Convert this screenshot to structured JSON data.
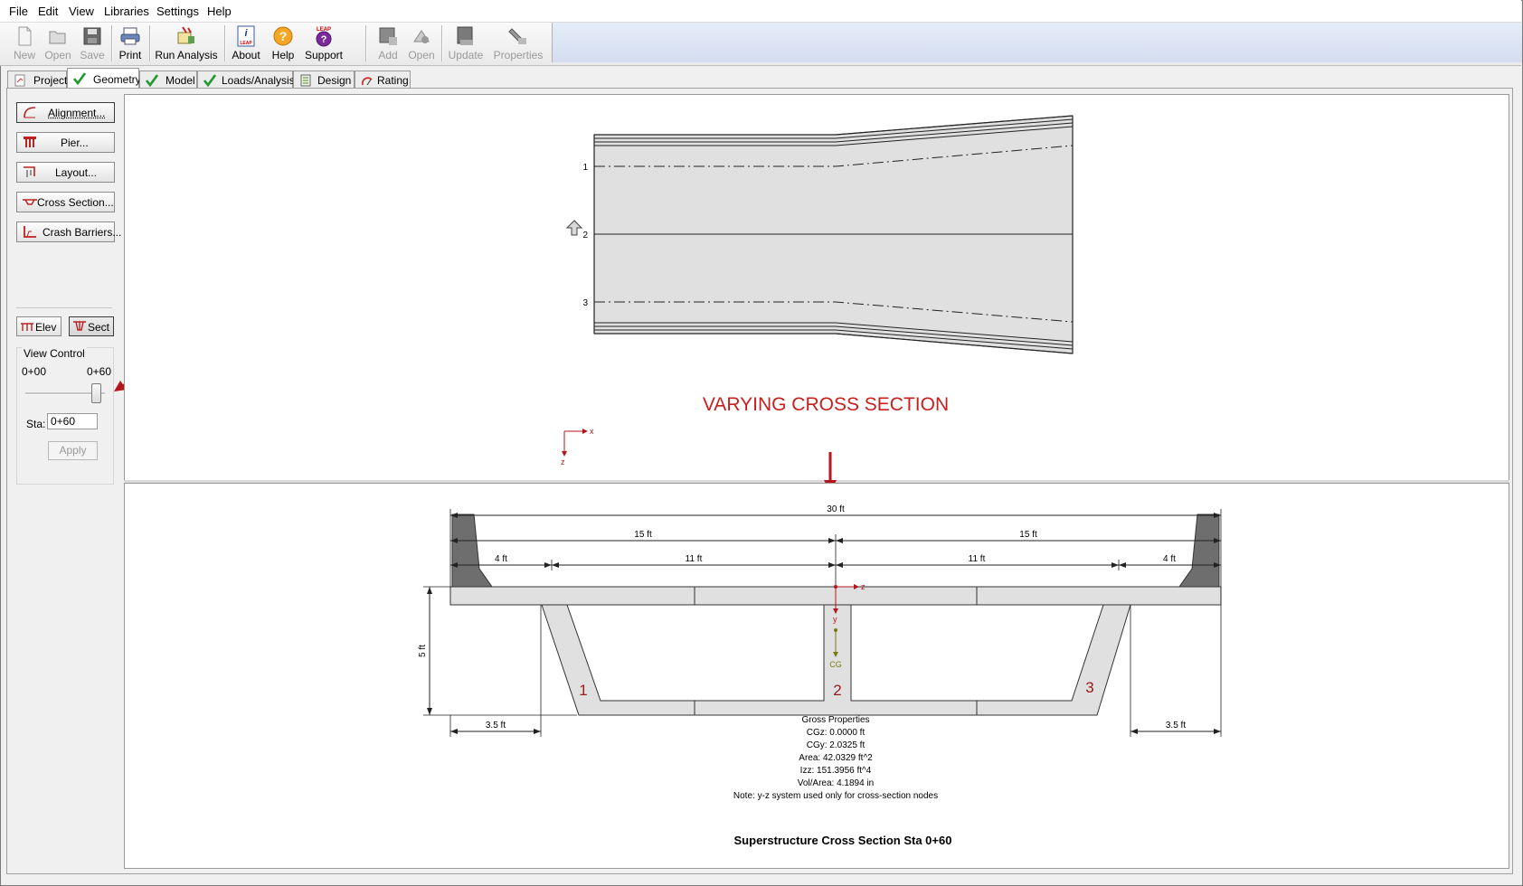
{
  "menu": [
    "File",
    "Edit",
    "View",
    "Libraries",
    "Settings",
    "Help"
  ],
  "toolbar": {
    "new": "New",
    "open": "Open",
    "save": "Save",
    "print": "Print",
    "run_analysis": "Run Analysis",
    "about": "About",
    "help": "Help",
    "support": "Support",
    "add": "Add",
    "open2": "Open",
    "update": "Update",
    "properties": "Properties",
    "about_badge": "LEAP",
    "support_badge": "LEAP"
  },
  "tabs": [
    "Project",
    "Geometry",
    "Model",
    "Loads/Analysis",
    "Design",
    "Rating"
  ],
  "active_tab": "Geometry",
  "sidebar": {
    "alignment": "Alignment...",
    "pier": "Pier...",
    "layout": "Layout...",
    "cross_section": "Cross Section...",
    "crash_barriers": "Crash Barriers...",
    "elev": "Elev",
    "sect": "Sect"
  },
  "view_control": {
    "title": "View Control",
    "min": "0+00",
    "max": "0+60",
    "slider_fraction": 1.0,
    "sta_label": "Sta:",
    "sta_value": "0+60",
    "apply": "Apply"
  },
  "plan_view": {
    "title": "VARYING CROSS SECTION",
    "girder_labels": [
      "1",
      "2",
      "3"
    ],
    "axis_x": "x",
    "axis_z": "z"
  },
  "section_view": {
    "dims": {
      "overall": "30 ft",
      "half_left": "15 ft",
      "half_right": "15 ft",
      "left_overhang": "4 ft",
      "left_lane": "11 ft",
      "right_lane": "11 ft",
      "right_overhang": "4 ft",
      "depth": "5 ft",
      "bottom_left": "3.5 ft",
      "bottom_right": "3.5 ft"
    },
    "web_labels": [
      "1",
      "2",
      "3"
    ],
    "axis_z": "z",
    "axis_y": "y",
    "cg_label": "CG",
    "properties": {
      "heading": "Gross Properties",
      "lines": [
        "CGz:  0.0000 ft",
        "CGy:  2.0325 ft",
        "Area:  42.0329 ft^2",
        "Izz:  151.3956 ft^4",
        "Vol/Area:  4.1894 in",
        "Note: y-z system used only for cross-section nodes"
      ]
    },
    "caption": "Superstructure Cross Section Sta 0+60"
  },
  "colors": {
    "annotation_red": "#b4161b",
    "title_red": "#c8201e",
    "deck_fill": "#e0e0e0",
    "barrier_fill": "#6e6e6e",
    "check_green": "#1f9a2d"
  }
}
